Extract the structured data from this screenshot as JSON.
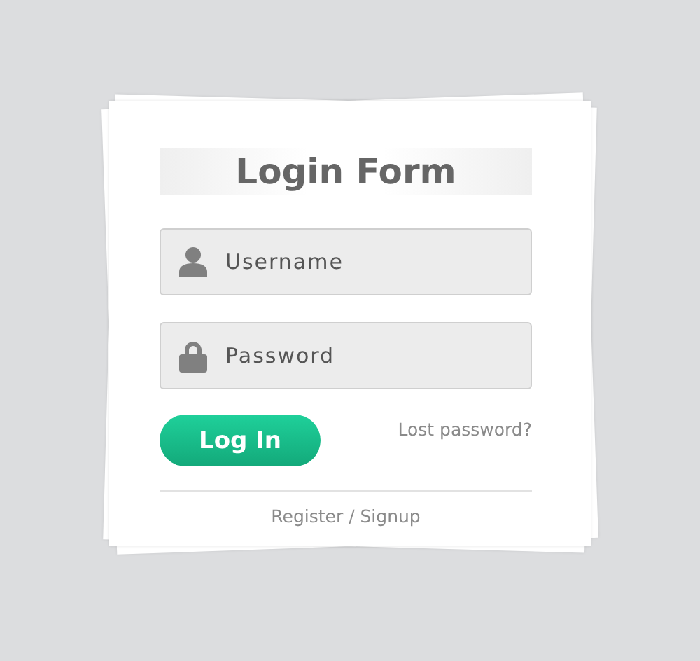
{
  "title": "Login Form",
  "fields": [
    {
      "kind": "user",
      "placeholder": "Username"
    },
    {
      "kind": "lock",
      "placeholder": "Password"
    }
  ],
  "login_button": "Log In",
  "lost_password_link": "Lost password?",
  "register_link": "Register / Signup"
}
